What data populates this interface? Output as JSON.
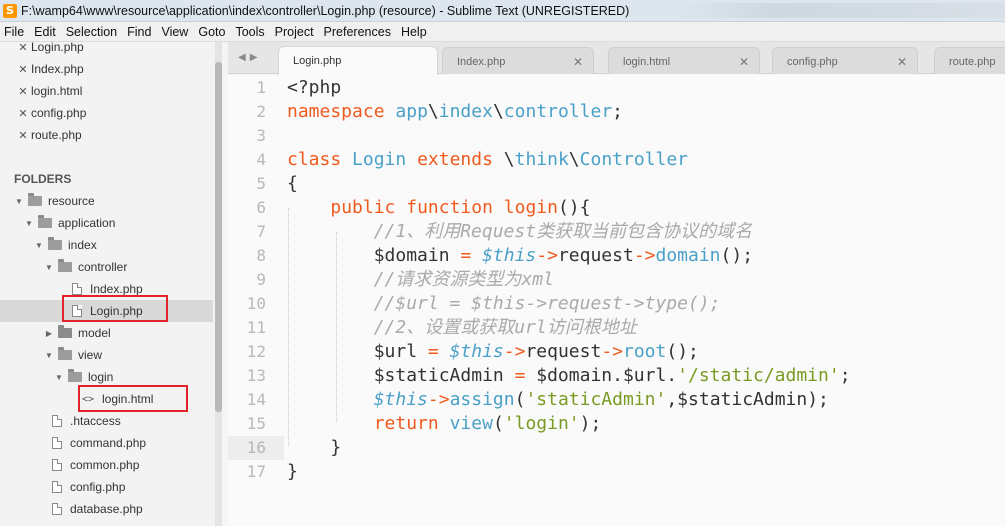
{
  "window": {
    "title": "F:\\wamp64\\www\\resource\\application\\index\\controller\\Login.php (resource) - Sublime Text (UNREGISTERED)",
    "app_icon": "sublime-text-icon"
  },
  "menu": [
    "File",
    "Edit",
    "Selection",
    "Find",
    "View",
    "Goto",
    "Tools",
    "Project",
    "Preferences",
    "Help"
  ],
  "open_files": [
    "Login.php",
    "Index.php",
    "login.html",
    "config.php",
    "route.php"
  ],
  "folders_label": "FOLDERS",
  "tree": [
    {
      "label": "resource",
      "kind": "folder-open"
    },
    {
      "label": "application",
      "kind": "folder-open"
    },
    {
      "label": "index",
      "kind": "folder-open"
    },
    {
      "label": "controller",
      "kind": "folder-open"
    },
    {
      "label": "Index.php",
      "kind": "file"
    },
    {
      "label": "Login.php",
      "kind": "file",
      "selected": true,
      "highlighted": true
    },
    {
      "label": "model",
      "kind": "folder-closed"
    },
    {
      "label": "view",
      "kind": "folder-open"
    },
    {
      "label": "login",
      "kind": "folder-open"
    },
    {
      "label": "login.html",
      "kind": "code-file",
      "highlighted": true
    },
    {
      "label": ".htaccess",
      "kind": "file"
    },
    {
      "label": "command.php",
      "kind": "file"
    },
    {
      "label": "common.php",
      "kind": "file"
    },
    {
      "label": "config.php",
      "kind": "file"
    },
    {
      "label": "database.php",
      "kind": "file"
    }
  ],
  "tabs": [
    {
      "label": "Login.php",
      "active": true
    },
    {
      "label": "Index.php"
    },
    {
      "label": "login.html"
    },
    {
      "label": "config.php"
    },
    {
      "label": "route.php"
    }
  ],
  "editor": {
    "current_line": 16,
    "lines": [
      {
        "no": "1",
        "tokens": [
          [
            "",
            "<?php"
          ]
        ]
      },
      {
        "no": "2",
        "tokens": [
          [
            "k",
            "namespace"
          ],
          [
            "",
            " "
          ],
          [
            "c",
            "app"
          ],
          [
            "",
            "\\"
          ],
          [
            "c",
            "index"
          ],
          [
            "",
            "\\"
          ],
          [
            "c",
            "controller"
          ],
          [
            "",
            ";"
          ]
        ]
      },
      {
        "no": "3",
        "tokens": []
      },
      {
        "no": "4",
        "tokens": [
          [
            "k",
            "class"
          ],
          [
            "",
            " "
          ],
          [
            "c",
            "Login"
          ],
          [
            "",
            " "
          ],
          [
            "k",
            "extends"
          ],
          [
            "",
            " \\"
          ],
          [
            "c",
            "think"
          ],
          [
            "",
            "\\"
          ],
          [
            "c",
            "Controller"
          ]
        ]
      },
      {
        "no": "5",
        "tokens": [
          [
            "",
            "{"
          ]
        ]
      },
      {
        "no": "6",
        "tokens": [
          [
            "",
            "    "
          ],
          [
            "k",
            "public"
          ],
          [
            "",
            " "
          ],
          [
            "k",
            "function"
          ],
          [
            "",
            " "
          ],
          [
            "o",
            "login"
          ],
          [
            "",
            "(){"
          ]
        ]
      },
      {
        "no": "7",
        "tokens": [
          [
            "",
            "        "
          ],
          [
            "cm",
            "//1、利用Request类获取当前包含协议的域名"
          ]
        ]
      },
      {
        "no": "8",
        "tokens": [
          [
            "",
            "        $domain "
          ],
          [
            "o",
            "="
          ],
          [
            "",
            " "
          ],
          [
            "v",
            "$this"
          ],
          [
            "o",
            "->"
          ],
          [
            "",
            "request"
          ],
          [
            "o",
            "->"
          ],
          [
            "fn",
            "domain"
          ],
          [
            "",
            "();"
          ]
        ]
      },
      {
        "no": "9",
        "tokens": [
          [
            "",
            "        "
          ],
          [
            "cm",
            "//请求资源类型为xml"
          ]
        ]
      },
      {
        "no": "10",
        "tokens": [
          [
            "",
            "        "
          ],
          [
            "cm",
            "//$url = $this->request->type();"
          ]
        ]
      },
      {
        "no": "11",
        "tokens": [
          [
            "",
            "        "
          ],
          [
            "cm",
            "//2、设置或获取url访问根地址"
          ]
        ]
      },
      {
        "no": "12",
        "tokens": [
          [
            "",
            "        $url "
          ],
          [
            "o",
            "="
          ],
          [
            "",
            " "
          ],
          [
            "v",
            "$this"
          ],
          [
            "o",
            "->"
          ],
          [
            "",
            "request"
          ],
          [
            "o",
            "->"
          ],
          [
            "fn",
            "root"
          ],
          [
            "",
            "();"
          ]
        ]
      },
      {
        "no": "13",
        "tokens": [
          [
            "",
            "        $staticAdmin "
          ],
          [
            "o",
            "="
          ],
          [
            "",
            " $domain.$url."
          ],
          [
            "s",
            "'/static/admin'"
          ],
          [
            "",
            ";"
          ]
        ]
      },
      {
        "no": "14",
        "tokens": [
          [
            "",
            "        "
          ],
          [
            "v",
            "$this"
          ],
          [
            "o",
            "->"
          ],
          [
            "fn",
            "assign"
          ],
          [
            "",
            "("
          ],
          [
            "s",
            "'staticAdmin'"
          ],
          [
            "",
            ",$staticAdmin);"
          ]
        ]
      },
      {
        "no": "15",
        "tokens": [
          [
            "",
            "        "
          ],
          [
            "k",
            "return"
          ],
          [
            "",
            " "
          ],
          [
            "fn",
            "view"
          ],
          [
            "",
            "("
          ],
          [
            "s",
            "'login'"
          ],
          [
            "",
            ");"
          ]
        ]
      },
      {
        "no": "16",
        "tokens": [
          [
            "",
            "    }"
          ]
        ]
      },
      {
        "no": "17",
        "tokens": [
          [
            "",
            "}"
          ]
        ]
      }
    ]
  },
  "colors": {
    "keyword": "#f05a1e",
    "identifier": "#4aa0c8",
    "string": "#7a9b23",
    "comment": "#aaaaaa",
    "highlight_box": "#e0242a"
  }
}
